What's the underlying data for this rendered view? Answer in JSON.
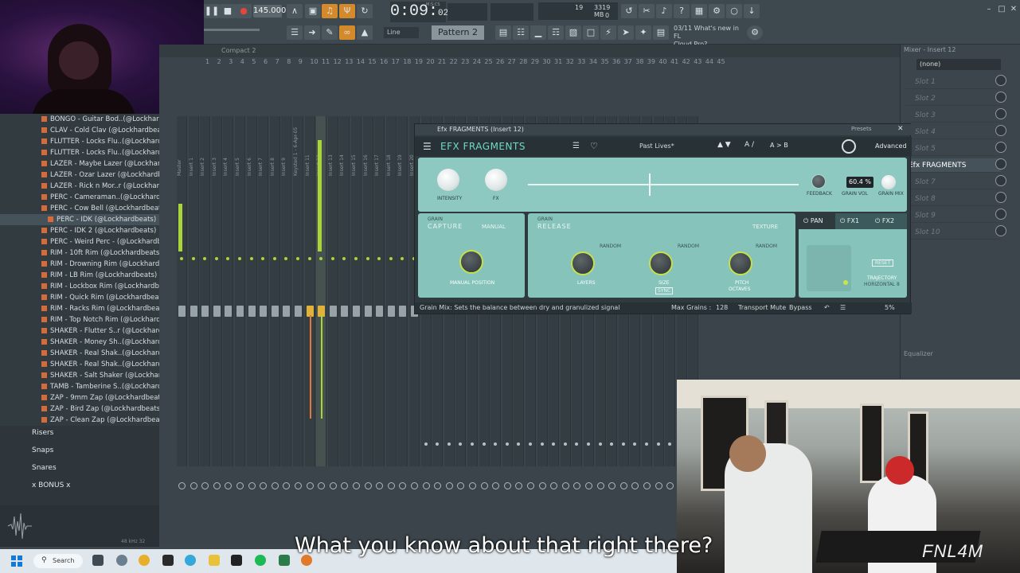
{
  "toolbar": {
    "bpm": "145.000",
    "time_main": "0:09:",
    "time_sub": "02",
    "time_unit": "M:S:CS",
    "cpu_label": "19",
    "ram_label": "3319 MB",
    "ram_sub": "0",
    "mode_select": "Line",
    "pattern": "Pattern 2",
    "news_line1": "03/11  What's new in FL",
    "news_line2": "Cloud Pro?"
  },
  "browser": {
    "items": [
      "BONGO - Guitar Bod..(@Lockhardbeats)",
      "CLAV - Cold Clav (@Lockhardbeats)",
      "FLUTTER - Locks Flu..(@Lockhardbeats)",
      "FLUTTER - Locks Flu..(@Lockhardbeats)",
      "LAZER - Maybe Lazer (@Lockhardbeats)",
      "LAZER - Ozar Lazer (@Lockhardbeats)",
      "LAZER - Rick n Mor..r (@Lockhardbeats)",
      "PERC - Cameraman..(@Lockhardbeats)",
      "PERC - Cow Bell (@Lockhardbeats)",
      "PERC - IDK (@Lockhardbeats)",
      "PERC - IDK 2 (@Lockhardbeats)",
      "PERC - Weird Perc - (@Lockhardbeats)",
      "RIM - 10ft Rim (@Lockhardbeats)",
      "RIM - Drowning Rim (@Lockhardbeats)",
      "RIM - LB Rim (@Lockhardbeats)",
      "RIM - Lockbox Rim (@Lockhardbeats)",
      "RIM - Quick Rim (@Lockhardbeats)",
      "RIM - Racks Rim (@Lockhardbeats)",
      "RIM - Top Notch Rim (@Lockhardbeats)",
      "SHAKER - Flutter S..r (@Lockhardbeats)",
      "SHAKER - Money Sh..(@Lockhardbeats)",
      "SHAKER - Real Shak..(@Lockhardbeats)",
      "SHAKER - Real Shak..(@Lockhardbeats)",
      "SHAKER - Salt Shaker (@Lockhardbeats)",
      "TAMB - Tamberine S..(@Lockhardbeats)",
      "ZAP - 9mm Zap (@Lockhardbeats)",
      "ZAP - Bird Zap (@Lockhardbeats)",
      "ZAP - Clean Zap (@Lockhardbeats)"
    ],
    "selected_index": 9,
    "folders": [
      "Risers",
      "Snaps",
      "Snares",
      "x BONUS x"
    ],
    "bottom_label": "48 kHz 32"
  },
  "mixer": {
    "header": "Compact 2",
    "ruler": [
      "1",
      "2",
      "3",
      "4",
      "5",
      "6",
      "7",
      "8",
      "9",
      "10",
      "11",
      "12",
      "13",
      "14",
      "15",
      "16",
      "17",
      "18",
      "19",
      "20",
      "21",
      "22",
      "23",
      "24",
      "25",
      "26",
      "27",
      "28",
      "29",
      "30",
      "31",
      "32",
      "33",
      "34",
      "35",
      "36",
      "37",
      "38",
      "39",
      "40",
      "41",
      "42",
      "43",
      "44",
      "45"
    ],
    "tracks": [
      "Master",
      "Insert 1",
      "Insert 2",
      "Insert 3",
      "Insert 4",
      "Insert 5",
      "Insert 6",
      "Insert 7",
      "Insert 8",
      "Insert 9",
      "Keysted 1 - 6-Apr-05",
      "Insert 11",
      "Insert 12",
      "Insert 13",
      "Insert 14",
      "Insert 15",
      "Insert 16",
      "Insert 17",
      "Insert 18",
      "Insert 19",
      "Insert 20"
    ],
    "panel_title": "Mixer - Insert 12",
    "route_select": "(none)",
    "slots": [
      "Slot 1",
      "Slot 2",
      "Slot 3",
      "Slot 4",
      "Slot 5",
      "Efx FRAGMENTS",
      "Slot 7",
      "Slot 8",
      "Slot 9",
      "Slot 10"
    ],
    "active_slot": 5,
    "eq_label": "Equalizer"
  },
  "plugin": {
    "window_title": "Efx FRAGMENTS (Insert 12)",
    "presets_label": "Presets",
    "name": "EFX FRAGMENTS",
    "preset": "Past Lives*",
    "ab_label": "A /",
    "ab_copy": "A > B",
    "advanced": "Advanced",
    "top_knobs": [
      "INTENSITY",
      "FX"
    ],
    "right_knobs": [
      "FEEDBACK",
      "GRAIN VOL",
      "GRAIN MIX"
    ],
    "grain_mix_value": "60.4 %",
    "capture_title": "CAPTURE",
    "capture_mode": "MANUAL",
    "capture_knob": "MANUAL POSITION",
    "release_title": "RELEASE",
    "release_mode": "TEXTURE",
    "release_knobs": [
      "LAYERS",
      "SIZE",
      "PITCH"
    ],
    "pitch_unit": "OCTAVES",
    "size_sub": "SYNC",
    "random_label": "RANDOM",
    "grain_label": "GRAIN",
    "tabs": [
      "PAN",
      "FX1",
      "FX2"
    ],
    "trajectory": "TRAJECTORY",
    "trajectory_sub": "HORIZONTAL 8",
    "reset": "RESET",
    "status": "Grain Mix: Sets the balance between dry and granulized signal",
    "max_grains_label": "Max Grains :",
    "max_grains": "128",
    "transport_mute": "Transport Mute",
    "bypass": "Bypass",
    "cpu": "5%"
  },
  "overlay": {
    "caption": "What you know about that right there?",
    "watermark": "FNL4M"
  },
  "taskbar": {
    "search": "Search"
  },
  "colors": {
    "accent_green": "#a9d43a",
    "plugin_teal": "#8ec9c1",
    "orange": "#e08a2a"
  }
}
